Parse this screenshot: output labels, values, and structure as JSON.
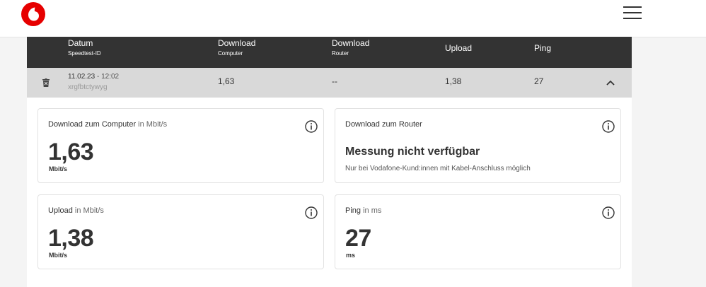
{
  "header": {
    "menu_icon": "hamburger-menu-icon",
    "logo_icon": "vodafone-logo-icon",
    "brand_color": "#e60000"
  },
  "table": {
    "columns": [
      {
        "label": "Datum",
        "sub": "Speedtest-ID"
      },
      {
        "label": "Download",
        "sub": "Computer"
      },
      {
        "label": "Download",
        "sub": "Router"
      },
      {
        "label": "Upload",
        "sub": ""
      },
      {
        "label": "Ping",
        "sub": ""
      }
    ],
    "row": {
      "date": "11.02.23",
      "time": " - 12:02",
      "id": "xrgfbtctywyg",
      "download_computer": "1,63",
      "download_router": "--",
      "upload": "1,38",
      "ping": "27"
    }
  },
  "cards": {
    "download_computer": {
      "title": "Download zum Computer",
      "unit_label": " in Mbit/s",
      "value": "1,63",
      "unit": "Mbit/s"
    },
    "download_router": {
      "title": "Download zum Router",
      "message": "Messung nicht verfügbar",
      "note": "Nur bei Vodafone-Kund:innen mit Kabel-Anschluss möglich"
    },
    "upload": {
      "title": "Upload",
      "unit_label": " in Mbit/s",
      "value": "1,38",
      "unit": "Mbit/s"
    },
    "ping": {
      "title": "Ping",
      "unit_label": " in ms",
      "value": "27",
      "unit": "ms"
    }
  }
}
